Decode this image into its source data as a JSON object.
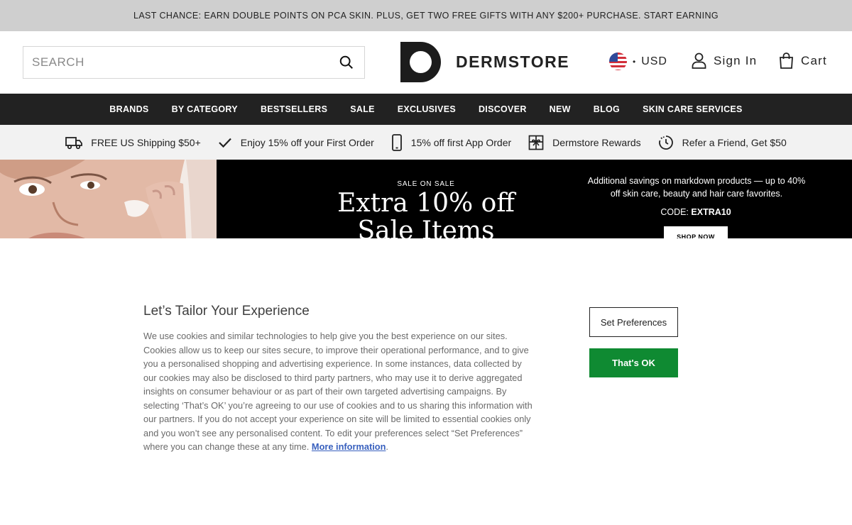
{
  "promo": {
    "text": "LAST CHANCE: EARN DOUBLE POINTS ON PCA SKIN. PLUS, GET TWO FREE GIFTS WITH ANY $200+ PURCHASE. START EARNING"
  },
  "header": {
    "search_placeholder": "SEARCH",
    "search_value": "",
    "logo_text": "DERMSTORE",
    "currency": "USD",
    "sign_in": "Sign In",
    "cart": "Cart"
  },
  "nav": {
    "items": [
      "BRANDS",
      "BY CATEGORY",
      "BESTSELLERS",
      "SALE",
      "EXCLUSIVES",
      "DISCOVER",
      "NEW",
      "BLOG",
      "SKIN CARE SERVICES"
    ]
  },
  "perks": [
    {
      "icon": "truck-icon",
      "label": "FREE US Shipping $50+"
    },
    {
      "icon": "check-icon",
      "label": "Enjoy 15% off your First Order"
    },
    {
      "icon": "phone-icon",
      "label": "15% off first App Order"
    },
    {
      "icon": "gift-icon",
      "label": "Dermstore Rewards"
    },
    {
      "icon": "refer-icon",
      "label": "Refer a Friend, Get $50"
    }
  ],
  "banner": {
    "eyebrow": "SALE ON SALE",
    "headline_line1": "Extra 10% off",
    "headline_line2": "Sale Items",
    "copy": "Additional savings on markdown products — up to 40% off skin care, beauty and hair care favorites.",
    "code_label": "CODE:",
    "code": "EXTRA10",
    "cta": "SHOP NOW"
  },
  "cookie": {
    "title": "Let’s Tailor Your Experience",
    "body": "We use cookies and similar technologies to help give you the best experience on our sites. Cookies allow us to keep our sites secure, to improve their operational performance, and to give you a personalised shopping and advertising experience. In some instances, data collected by our cookies may also be disclosed to third party partners, who may use it to derive aggregated insights on consumer behaviour or as part of their own targeted advertising campaigns. By selecting ‘That’s OK’ you’re agreeing to our use of cookies and to us sharing this information with our partners. If you do not accept your experience on site will be limited to essential cookies only and you won’t see any personalised content. To edit your preferences select “Set Preferences” where you can change these at any time.",
    "more_link": "More information",
    "set_preferences": "Set Preferences",
    "thats_ok": "That's OK"
  },
  "colors": {
    "promo_bg": "#cfcfcf",
    "nav_bg": "#222222",
    "perks_bg": "#f2f2f2",
    "accept_green": "#0f8a32",
    "link_blue": "#3860be"
  }
}
